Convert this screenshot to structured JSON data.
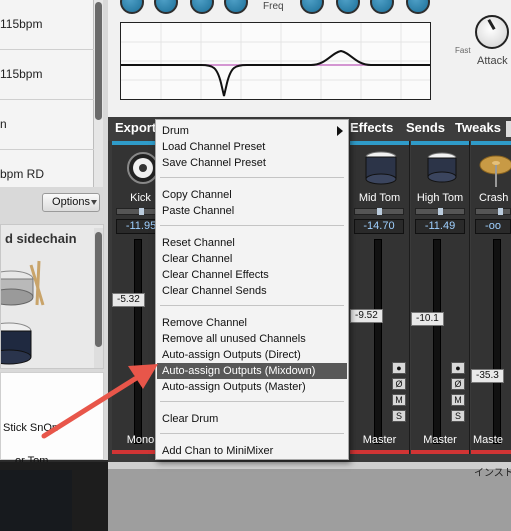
{
  "browser": {
    "presets": [
      "115bpm",
      "115bpm",
      "n",
      "bpm RD"
    ],
    "options_label": "Options",
    "kit_title": "d sidechain",
    "kit_items": [
      "Stick SnOn",
      "or Tom"
    ]
  },
  "eq": {
    "freq_label": "Freq",
    "fast_label": "Fast",
    "attack_label": "Attack"
  },
  "mixer": {
    "tabs": [
      "Export",
      "Effects",
      "Sends",
      "Tweaks"
    ],
    "channels": [
      {
        "name": "Kick",
        "db": "-11.95",
        "volume": "-5.32",
        "output": "Mono"
      },
      {
        "name": "Mid Tom",
        "db": "-14.70",
        "volume": "-9.52",
        "output": "Master"
      },
      {
        "name": "High Tom",
        "db": "-11.49",
        "volume": "-10.1",
        "output": "Master"
      },
      {
        "name": "Crash",
        "db": "-oo",
        "volume": "-35.3",
        "output": "Maste"
      }
    ],
    "buttons": [
      "●",
      "Ø",
      "M",
      "S"
    ],
    "footer_text": "インスト"
  },
  "context_menu": {
    "groups": [
      [
        "Drum",
        "Load Channel Preset",
        "Save Channel Preset"
      ],
      [
        "Copy Channel",
        "Paste Channel"
      ],
      [
        "Reset Channel",
        "Clear Channel",
        "Clear Channel Effects",
        "Clear Channel Sends"
      ],
      [
        "Remove Channel",
        "Remove all unused Channels",
        "Auto-assign Outputs (Direct)",
        "Auto-assign Outputs (Mixdown)",
        "Auto-assign Outputs (Master)"
      ],
      [
        "Clear Drum"
      ],
      [
        "Add Chan to MiniMixer"
      ]
    ],
    "highlighted": "Auto-assign Outputs (Mixdown)"
  },
  "colors": {
    "accent_blue": "#2f9bc9",
    "accent_red": "#d13434",
    "annotation_arrow": "#e8564a",
    "menu_highlight": "#585858"
  }
}
